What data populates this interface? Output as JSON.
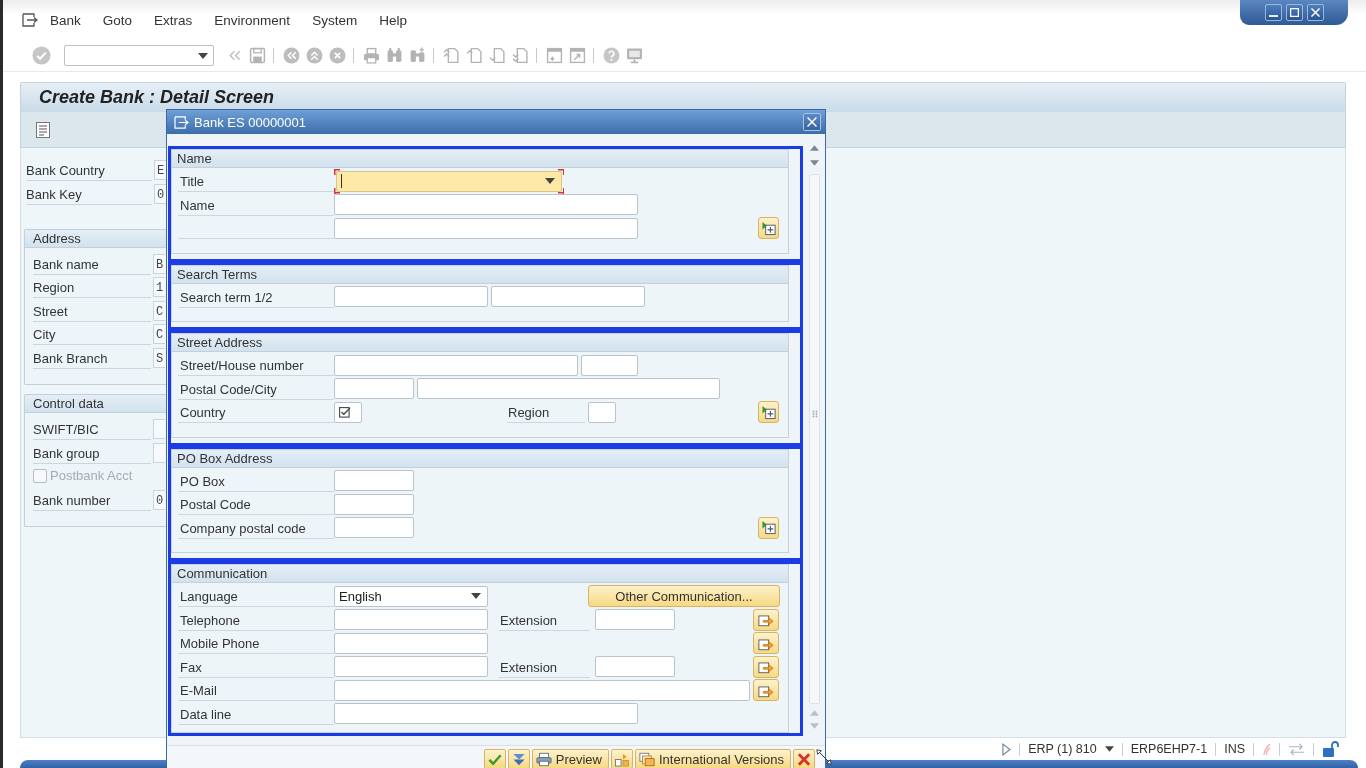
{
  "menu_bar": {
    "items": [
      "Bank",
      "Goto",
      "Extras",
      "Environment",
      "System",
      "Help"
    ]
  },
  "screen": {
    "title": "Create Bank : Detail Screen",
    "header_fields": [
      {
        "label": "Bank Country",
        "value": "E"
      },
      {
        "label": "Bank Key",
        "value": "0"
      }
    ],
    "groups": [
      {
        "title": "Address",
        "rows": [
          {
            "kind": "field",
            "label": "Bank name",
            "value": "B"
          },
          {
            "kind": "field",
            "label": "Region",
            "value": "1"
          },
          {
            "kind": "field",
            "label": "Street",
            "value": "C"
          },
          {
            "kind": "field",
            "label": "City",
            "value": "C"
          },
          {
            "kind": "field",
            "label": "Bank Branch",
            "value": "S"
          }
        ]
      },
      {
        "title": "Control data",
        "rows": [
          {
            "kind": "field",
            "label": "SWIFT/BIC"
          },
          {
            "kind": "field",
            "label": "Bank group"
          },
          {
            "kind": "checkbox",
            "label": "Postbank Acct",
            "checked": false,
            "disabled": true
          },
          {
            "kind": "field",
            "label": "Bank number",
            "value": "0"
          }
        ]
      }
    ]
  },
  "dialog": {
    "title": "Bank ES 00000001",
    "sections": [
      {
        "title": "Name",
        "highlighted": true,
        "rows": [
          {
            "label": "Title",
            "items": [
              {
                "kind": "dropdown",
                "focused": true,
                "required": false
              }
            ]
          },
          {
            "label": "Name",
            "items": [
              {
                "kind": "input",
                "focused": false,
                "required": false
              }
            ]
          },
          {
            "items": [
              {
                "kind": "input",
                "focused": false,
                "required": false
              },
              {
                "kind": "expand_button"
              }
            ]
          }
        ]
      },
      {
        "title": "Search Terms",
        "highlighted": true,
        "rows": [
          {
            "label": "Search term 1/2",
            "items": [
              {
                "kind": "input",
                "focused": false,
                "required": false
              },
              {
                "kind": "input",
                "focused": false,
                "required": false
              }
            ]
          }
        ]
      },
      {
        "title": "Street Address",
        "highlighted": true,
        "rows": [
          {
            "label": "Street/House number",
            "items": [
              {
                "kind": "input",
                "focused": false,
                "required": false
              },
              {
                "kind": "input",
                "focused": false,
                "required": false
              }
            ]
          },
          {
            "label": "Postal Code/City",
            "items": [
              {
                "kind": "input",
                "focused": false,
                "required": false
              },
              {
                "kind": "input",
                "focused": false,
                "required": false
              }
            ]
          },
          {
            "label": "Country",
            "items": [
              {
                "kind": "input",
                "focused": false,
                "required": true
              },
              {
                "kind": "label",
                "text": "Region"
              },
              {
                "kind": "input",
                "focused": false,
                "required": false
              },
              {
                "kind": "expand_button"
              }
            ]
          }
        ]
      },
      {
        "title": "PO Box Address",
        "highlighted": true,
        "rows": [
          {
            "label": "PO Box",
            "items": [
              {
                "kind": "input",
                "focused": false,
                "required": false
              }
            ]
          },
          {
            "label": "Postal Code",
            "items": [
              {
                "kind": "input",
                "focused": false,
                "required": false
              }
            ]
          },
          {
            "label": "Company postal code",
            "items": [
              {
                "kind": "input",
                "focused": false,
                "required": false
              },
              {
                "kind": "expand_button"
              }
            ]
          }
        ]
      },
      {
        "title": "Communication",
        "highlighted": true,
        "rows": [
          {
            "label": "Language",
            "items": [
              {
                "kind": "dropdown",
                "value": "English",
                "focused": false,
                "required": false
              },
              {
                "kind": "button",
                "text": "Other Communication..."
              }
            ]
          },
          {
            "label": "Telephone",
            "items": [
              {
                "kind": "input",
                "focused": false,
                "required": false
              },
              {
                "kind": "label",
                "text": "Extension"
              },
              {
                "kind": "input",
                "focused": false,
                "required": false
              },
              {
                "kind": "send_button"
              }
            ]
          },
          {
            "label": "Mobile Phone",
            "items": [
              {
                "kind": "input",
                "focused": false,
                "required": false
              },
              {
                "kind": "send_button"
              }
            ]
          },
          {
            "label": "Fax",
            "items": [
              {
                "kind": "input",
                "focused": false,
                "required": false
              },
              {
                "kind": "label",
                "text": "Extension"
              },
              {
                "kind": "input",
                "focused": false,
                "required": false
              },
              {
                "kind": "send_button"
              }
            ]
          },
          {
            "label": "E-Mail",
            "items": [
              {
                "kind": "input",
                "focused": false,
                "required": false
              },
              {
                "kind": "send_button"
              }
            ]
          },
          {
            "label": "Data line",
            "items": [
              {
                "kind": "input",
                "focused": false,
                "required": false
              }
            ]
          }
        ]
      }
    ],
    "buttons": [
      {
        "kind": "confirm"
      },
      {
        "kind": "expand"
      },
      {
        "kind": "print",
        "label": "Preview"
      },
      {
        "kind": "shapes"
      },
      {
        "kind": "versions",
        "label": "International Versions"
      },
      {
        "kind": "cancel"
      }
    ]
  },
  "status_bar": {
    "system": "ERP (1) 810",
    "server": "ERP6EHP7-1",
    "mode": "INS"
  }
}
